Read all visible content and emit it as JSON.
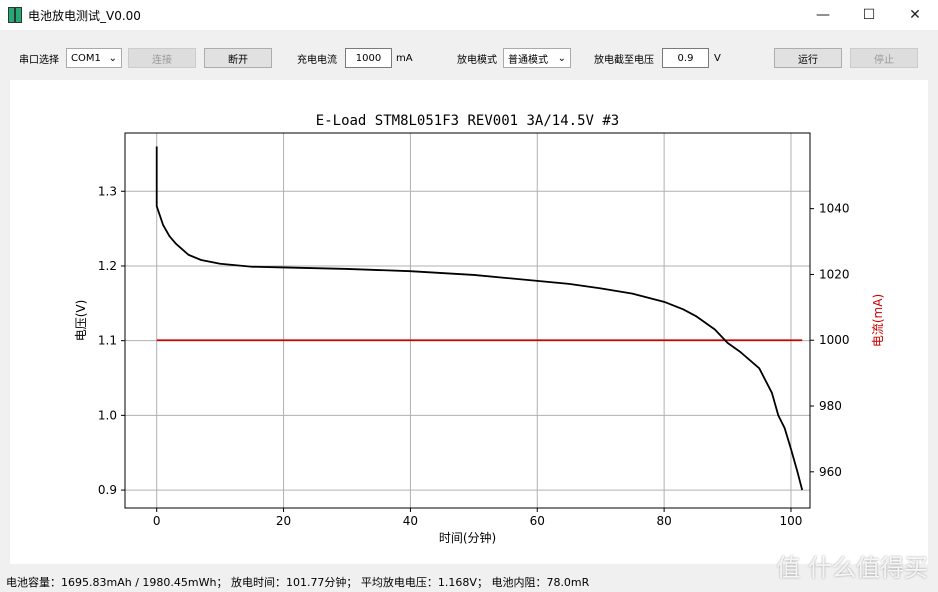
{
  "window": {
    "title": "电池放电测试_V0.00",
    "minimize": "—",
    "maximize": "☐",
    "close": "✕"
  },
  "toolbar": {
    "port_label": "串口选择",
    "port_value": "COM1",
    "connect": "连接",
    "disconnect": "断开",
    "current_label": "充电电流",
    "current_value": "1000",
    "current_unit": "mA",
    "mode_label": "放电模式",
    "mode_value": "普通模式",
    "cutoff_label": "放电截至电压",
    "cutoff_value": "0.9",
    "cutoff_unit": "V",
    "run": "运行",
    "stop": "停止"
  },
  "status": "电池容量：1695.83mAh / 1980.45mWh；  放电时间：101.77分钟；  平均放电电压：1.168V；  电池内阻：78.0mR",
  "watermark": "值 什么值得买",
  "colors": {
    "voltage": "#000000",
    "current": "#cc0000",
    "grid": "#b0b0b0"
  },
  "chart_data": {
    "type": "line",
    "title": "E-Load STM8L051F3 REV001 3A/14.5V #3",
    "xlabel": "时间(分钟)",
    "ylabel": "电压(V)",
    "y2label": "电流(mA)",
    "xlim": [
      -5,
      103
    ],
    "ylim": [
      0.876,
      1.378
    ],
    "y2lim": [
      949,
      1063
    ],
    "xticks": [
      0,
      20,
      40,
      60,
      80,
      100
    ],
    "yticks": [
      0.9,
      1.0,
      1.1,
      1.2,
      1.3
    ],
    "y2ticks": [
      960,
      980,
      1000,
      1020,
      1040
    ],
    "grid": true,
    "series": [
      {
        "axis": "left",
        "x": [
          0,
          0,
          1,
          2,
          3,
          5,
          7,
          10,
          15,
          20,
          30,
          40,
          50,
          60,
          65,
          70,
          75,
          80,
          83,
          85,
          88,
          90,
          92,
          95,
          97,
          98,
          99,
          100,
          101,
          101.77
        ],
        "y": [
          1.36,
          1.28,
          1.255,
          1.24,
          1.23,
          1.215,
          1.208,
          1.203,
          1.199,
          1.198,
          1.196,
          1.193,
          1.188,
          1.18,
          1.176,
          1.17,
          1.163,
          1.152,
          1.142,
          1.133,
          1.115,
          1.097,
          1.085,
          1.063,
          1.03,
          1.0,
          0.983,
          0.955,
          0.925,
          0.9
        ]
      },
      {
        "axis": "right",
        "x": [
          0,
          101.77
        ],
        "y": [
          1000,
          1000
        ]
      }
    ]
  }
}
